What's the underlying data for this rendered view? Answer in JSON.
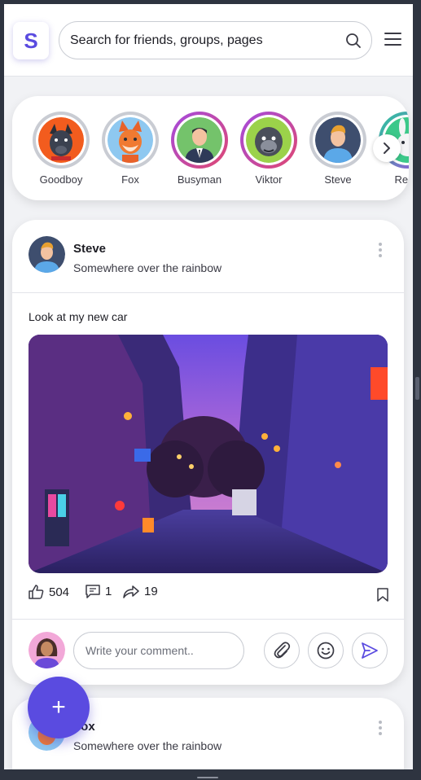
{
  "header": {
    "logo_letter": "S",
    "search_placeholder": "Search for friends, groups, pages"
  },
  "stories": [
    {
      "name": "Goodboy",
      "avatar": "dog-avatar",
      "ring": "gray"
    },
    {
      "name": "Fox",
      "avatar": "fox-avatar",
      "ring": "gray"
    },
    {
      "name": "Busyman",
      "avatar": "businessman-avatar",
      "ring": "gradient"
    },
    {
      "name": "Viktor",
      "avatar": "gorilla-avatar",
      "ring": "gradient"
    },
    {
      "name": "Steve",
      "avatar": "man-avatar",
      "ring": "gray"
    },
    {
      "name": "Rebe",
      "avatar": "rabbit-avatar",
      "ring": "gradient"
    }
  ],
  "post": {
    "author": "Steve",
    "location": "Somewhere over the rainbow",
    "text": "Look at my new car",
    "likes": "504",
    "comments": "1",
    "shares": "19",
    "comment_placeholder": "Write your comment.."
  },
  "post2": {
    "author": "Fox",
    "location": "Somewhere over the rainbow"
  },
  "fab_label": "+",
  "colors": {
    "accent": "#5a4be0",
    "background": "#f1f2f5",
    "card": "#ffffff",
    "border": "#c9ccd3"
  }
}
